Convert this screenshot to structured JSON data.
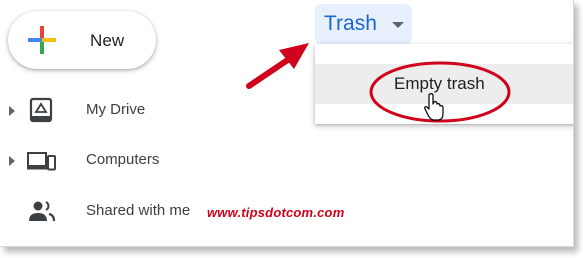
{
  "new_button": {
    "label": "New",
    "icon": "plus-icon"
  },
  "sidebar": {
    "items": [
      {
        "label": "My Drive",
        "icon": "my-drive-icon",
        "expandable": true
      },
      {
        "label": "Computers",
        "icon": "computers-icon",
        "expandable": true
      },
      {
        "label": "Shared with me",
        "icon": "shared-with-me-icon",
        "expandable": false
      }
    ]
  },
  "breadcrumb": {
    "label": "Trash",
    "icon": "caret-down-icon"
  },
  "dropdown_menu": {
    "items": [
      {
        "label": "Empty trash"
      }
    ]
  },
  "watermark": "www.tipsdotcom.com",
  "colors": {
    "accent": "#1967d2",
    "chip_background": "#e8f0fe",
    "annotation_red": "#d0021b",
    "menu_hover": "#ededed"
  }
}
